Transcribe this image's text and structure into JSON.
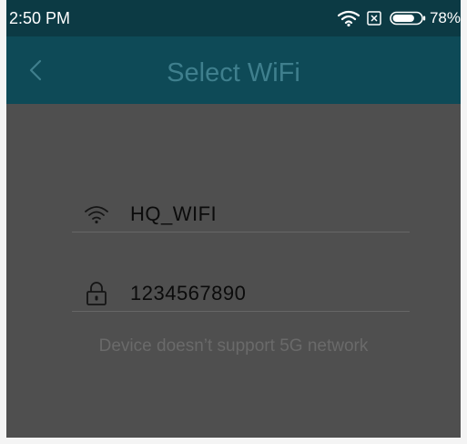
{
  "status_bar": {
    "time": "2:50 PM",
    "battery_percent": "78%",
    "battery_level": 0.78,
    "icons": [
      "wifi-icon",
      "sim-x-icon",
      "battery-icon"
    ]
  },
  "app_bar": {
    "title": "Select WiFi",
    "back_icon": "chevron-left-icon"
  },
  "form": {
    "ssid_value": "HQ_WIFI",
    "ssid_icon": "wifi-icon",
    "password_value": "1234567890",
    "password_icon": "lock-icon"
  },
  "notice": "Device doesn’t support 5G network",
  "colors": {
    "status_bar_bg": "#0c3a44",
    "app_bar_bg": "#0e4a57",
    "title_color": "#3f7f8d",
    "overlay_bg": "#4f4f4f"
  }
}
